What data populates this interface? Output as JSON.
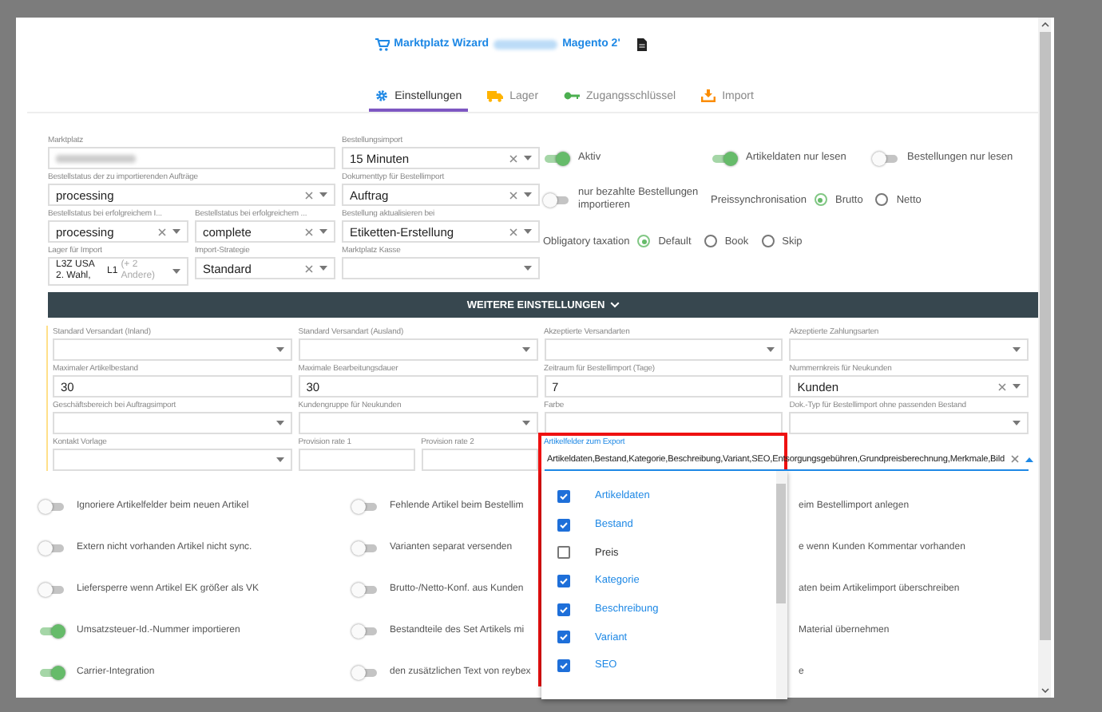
{
  "header": {
    "title_start": "Marktplatz Wizard",
    "title_end": "Magento 2'"
  },
  "tabs": [
    {
      "label": "Einstellungen",
      "selected": true
    },
    {
      "label": "Lager",
      "selected": false
    },
    {
      "label": "Zugangsschlüssel",
      "selected": false
    },
    {
      "label": "Import",
      "selected": false
    }
  ],
  "main_rows": [
    {
      "fields": [
        {
          "kind": "blurred",
          "label": "Marktplatz"
        },
        {
          "kind": "select",
          "label": "Bestellungsimport",
          "value": "15 Minuten",
          "clearable": true
        }
      ]
    },
    {
      "fields": [
        {
          "kind": "select",
          "label": "Bestellstatus der zu importierenden Aufträge",
          "value": "processing",
          "clearable": true
        },
        {
          "kind": "select",
          "label": "Dokumenttyp für Bestellimport",
          "value": "Auftrag",
          "clearable": true
        }
      ]
    },
    {
      "fields": [
        {
          "kind": "select",
          "label": "Bestellstatus bei erfolgreichem I...",
          "value": "processing",
          "clearable": true
        },
        {
          "kind": "select",
          "label": "Bestellstatus bei erfolgreichem ...",
          "value": "complete",
          "clearable": true
        },
        {
          "kind": "select",
          "label": "Bestellung aktualisieren bei",
          "value": "Etiketten-Erstellung",
          "clearable": true
        }
      ]
    },
    {
      "fields": [
        {
          "kind": "multi",
          "label": "Lager für Import",
          "values": [
            "L3Z USA 2. Wahl,",
            "L1"
          ],
          "more": "(+ 2 Andere)"
        },
        {
          "kind": "select",
          "label": "Import-Strategie",
          "value": "Standard",
          "clearable": true
        },
        {
          "kind": "select",
          "label": "Marktplatz Kasse",
          "clearable": false
        }
      ]
    }
  ],
  "option_rows": [
    {
      "items": [
        {
          "kind": "switch",
          "label": "Aktiv",
          "on": true
        },
        {
          "kind": "switch",
          "label": "Artikeldaten nur lesen",
          "on": true
        },
        {
          "kind": "switch",
          "label": "Bestellungen nur lesen",
          "on": false
        }
      ]
    },
    {
      "items": [
        {
          "kind": "switch",
          "label": "nur bezahlte Bestellungen importieren",
          "on": false
        },
        {
          "kind": "radio",
          "label": "Preissynchronisation",
          "options": [
            {
              "label": "Brutto",
              "selected": true
            },
            {
              "label": "Netto",
              "selected": false
            }
          ]
        }
      ]
    },
    {
      "items": [
        {
          "kind": "radio",
          "label": "Obligatory taxation",
          "options": [
            {
              "label": "Default",
              "selected": true
            },
            {
              "label": "Book",
              "selected": false
            },
            {
              "label": "Skip",
              "selected": false
            }
          ]
        }
      ]
    }
  ],
  "more_settings": {
    "label": "WEITERE EINSTELLUNGEN"
  },
  "extra_rows": [
    {
      "fields": [
        {
          "kind": "select",
          "label": "Standard Versandart (Inland)",
          "clearable": false
        },
        {
          "kind": "select",
          "label": "Standard Versandart (Ausland)",
          "clearable": false
        },
        {
          "kind": "select",
          "label": "Akzeptierte Versandarten",
          "clearable": false
        },
        {
          "kind": "select",
          "label": "Akzeptierte Zahlungsarten",
          "clearable": false
        }
      ]
    },
    {
      "fields": [
        {
          "kind": "text",
          "label": "Maximaler Artikelbestand",
          "value": "30"
        },
        {
          "kind": "text",
          "label": "Maximale Bearbeitungsdauer",
          "value": "30"
        },
        {
          "kind": "text",
          "label": "Zeitraum für Bestellimport (Tage)",
          "value": "7"
        },
        {
          "kind": "select",
          "label": "Nummernkreis für Neukunden",
          "value": "Kunden",
          "clearable": true
        }
      ]
    },
    {
      "fields": [
        {
          "kind": "select",
          "label": "Geschäftsbereich bei Auftragsimport",
          "clearable": false
        },
        {
          "kind": "select",
          "label": "Kundengruppe für Neukunden",
          "clearable": false
        },
        {
          "kind": "text",
          "label": "Farbe"
        },
        {
          "kind": "select",
          "label": "Dok.-Typ für Bestellimport ohne passenden Bestand",
          "clearable": false
        }
      ]
    },
    {
      "fields": [
        {
          "kind": "select",
          "label": "Kontakt Vorlage",
          "clearable": false
        },
        {
          "kind": "pair",
          "fields": [
            {
              "kind": "text",
              "label": "Provision rate 1"
            },
            {
              "kind": "text",
              "label": "Provision rate 2"
            }
          ]
        },
        {
          "kind": "tags",
          "label": "Artikelfelder zum Export",
          "value": "Artikeldaten,Bestand,Kategorie,Beschreibung,Variant,SEO,Entsorgungsgebühren,Grundpreisberechnung,Merkmale,Bild",
          "clearable": true,
          "focused": true,
          "options": [
            {
              "label": "Artikeldaten",
              "checked": true
            },
            {
              "label": "Bestand",
              "checked": true
            },
            {
              "label": "Preis",
              "checked": false
            },
            {
              "label": "Kategorie",
              "checked": true
            },
            {
              "label": "Beschreibung",
              "checked": true
            },
            {
              "label": "Variant",
              "checked": true
            },
            {
              "label": "SEO",
              "checked": true
            }
          ]
        }
      ]
    }
  ],
  "flag_columns": [
    {
      "kind": "full",
      "items": [
        {
          "label": "Ignoriere Artikelfelder beim neuen Artikel",
          "on": false
        },
        {
          "label": "Extern nicht vorhanden Artikel nicht sync.",
          "on": false
        },
        {
          "label": "Liefersperre wenn Artikel EK größer als VK",
          "on": false
        },
        {
          "label": "Umsatzsteuer-Id.-Nummer importieren",
          "on": true
        },
        {
          "label": "Carrier-Integration",
          "on": true
        }
      ]
    },
    {
      "kind": "full",
      "items": [
        {
          "label": "Fehlende Artikel beim Bestellim",
          "on": false
        },
        {
          "label": "Varianten separat versenden",
          "on": false
        },
        {
          "label": "Brutto-/Netto-Konf. aus Kunden",
          "on": false
        },
        {
          "label": "Bestandteile des Set Artikels mi",
          "on": false
        },
        {
          "label": "den zusätzlichen Text von reybex",
          "on": false
        }
      ]
    },
    {
      "kind": "covered",
      "items": [
        {
          "label": "eim Bestellimport anlegen"
        },
        {
          "label": "e wenn Kunden Kommentar vorhanden"
        },
        {
          "label": "aten beim Artikelimport überschreiben"
        },
        {
          "label": "Material übernehmen"
        },
        {
          "label": "e"
        }
      ]
    }
  ]
}
